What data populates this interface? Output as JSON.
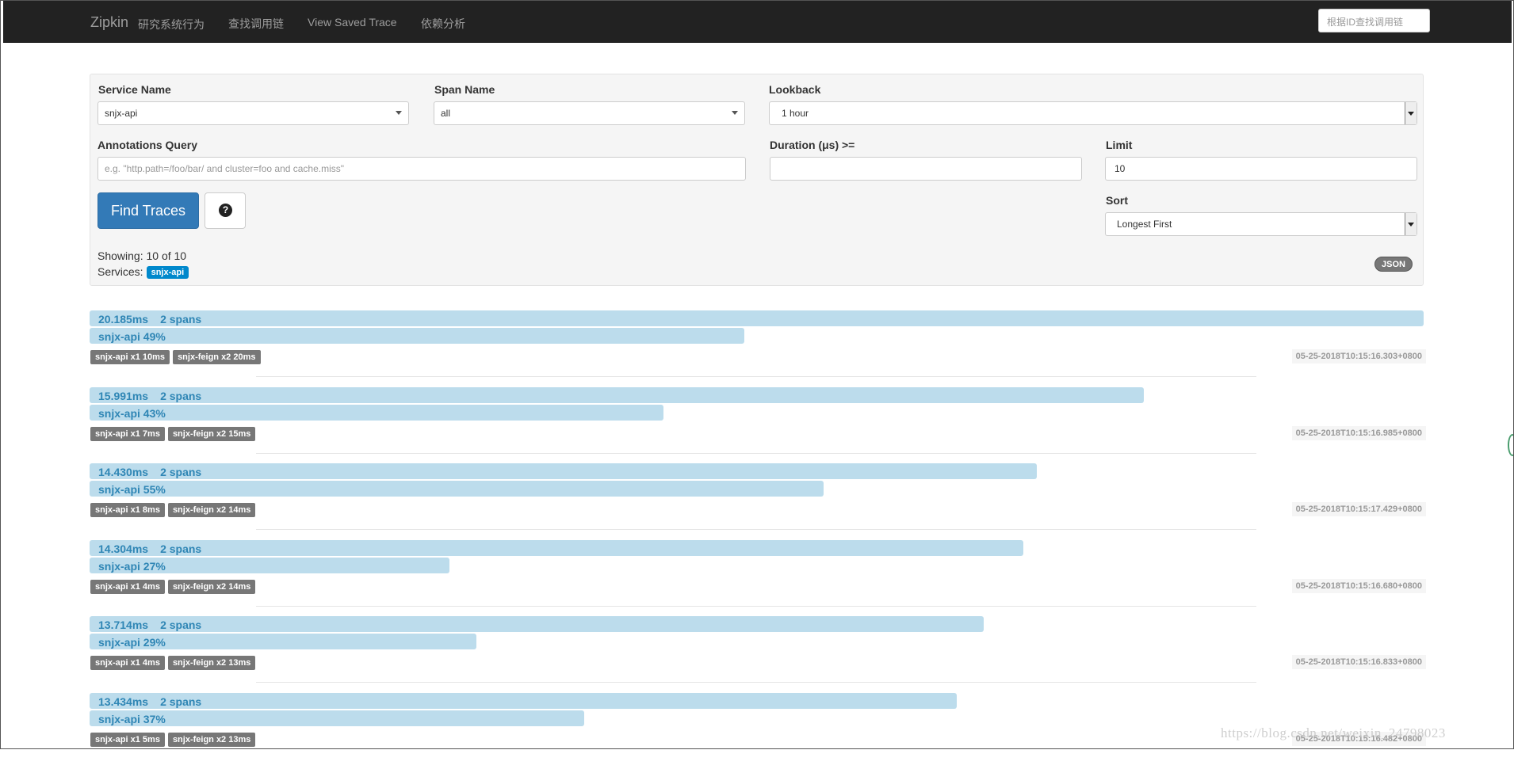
{
  "navbar": {
    "brand": "Zipkin",
    "subtitle": "研究系统行为",
    "links": [
      "查找调用链",
      "View Saved Trace",
      "依赖分析"
    ],
    "search_placeholder": "根据ID查找调用链"
  },
  "form": {
    "service_name": {
      "label": "Service Name",
      "value": "snjx-api"
    },
    "span_name": {
      "label": "Span Name",
      "value": "all"
    },
    "lookback": {
      "label": "Lookback",
      "value": "1 hour"
    },
    "annotations_query": {
      "label": "Annotations Query",
      "placeholder": "e.g. \"http.path=/foo/bar/ and cluster=foo and cache.miss\""
    },
    "duration": {
      "label": "Duration (μs) >=",
      "value": ""
    },
    "limit": {
      "label": "Limit",
      "value": "10"
    },
    "sort": {
      "label": "Sort",
      "value": "Longest First"
    },
    "find_button": "Find Traces",
    "help_icon": "question-circle-icon"
  },
  "results": {
    "showing": "Showing: 10 of 10",
    "services_label": "Services:",
    "service_badge": "snjx-api",
    "json_badge": "JSON"
  },
  "traces": [
    {
      "duration": "20.185ms",
      "spans": "2 spans",
      "service": "snjx-api 49%",
      "duration_pct": 100,
      "service_pct": 49,
      "tags": [
        "snjx-api x1 10ms",
        "snjx-feign x2 20ms"
      ],
      "timestamp": "05-25-2018T10:15:16.303+0800"
    },
    {
      "duration": "15.991ms",
      "spans": "2 spans",
      "service": "snjx-api 43%",
      "duration_pct": 79,
      "service_pct": 43,
      "tags": [
        "snjx-api x1 7ms",
        "snjx-feign x2 15ms"
      ],
      "timestamp": "05-25-2018T10:15:16.985+0800"
    },
    {
      "duration": "14.430ms",
      "spans": "2 spans",
      "service": "snjx-api 55%",
      "duration_pct": 71,
      "service_pct": 55,
      "tags": [
        "snjx-api x1 8ms",
        "snjx-feign x2 14ms"
      ],
      "timestamp": "05-25-2018T10:15:17.429+0800"
    },
    {
      "duration": "14.304ms",
      "spans": "2 spans",
      "service": "snjx-api 27%",
      "duration_pct": 70,
      "service_pct": 27,
      "tags": [
        "snjx-api x1 4ms",
        "snjx-feign x2 14ms"
      ],
      "timestamp": "05-25-2018T10:15:16.680+0800"
    },
    {
      "duration": "13.714ms",
      "spans": "2 spans",
      "service": "snjx-api 29%",
      "duration_pct": 67,
      "service_pct": 29,
      "tags": [
        "snjx-api x1 4ms",
        "snjx-feign x2 13ms"
      ],
      "timestamp": "05-25-2018T10:15:16.833+0800"
    },
    {
      "duration": "13.434ms",
      "spans": "2 spans",
      "service": "snjx-api 37%",
      "duration_pct": 65,
      "service_pct": 37,
      "tags": [
        "snjx-api x1 5ms",
        "snjx-feign x2 13ms"
      ],
      "timestamp": "05-25-2018T10:15:16.482+0800"
    }
  ],
  "watermark": "https://blog.csdn.net/weixin_24798023",
  "colors": {
    "navbar": "#222222",
    "primary": "#337ab7",
    "bar": "#bcdcec",
    "bar_text": "#2f86b5",
    "badge": "#0088cc"
  }
}
